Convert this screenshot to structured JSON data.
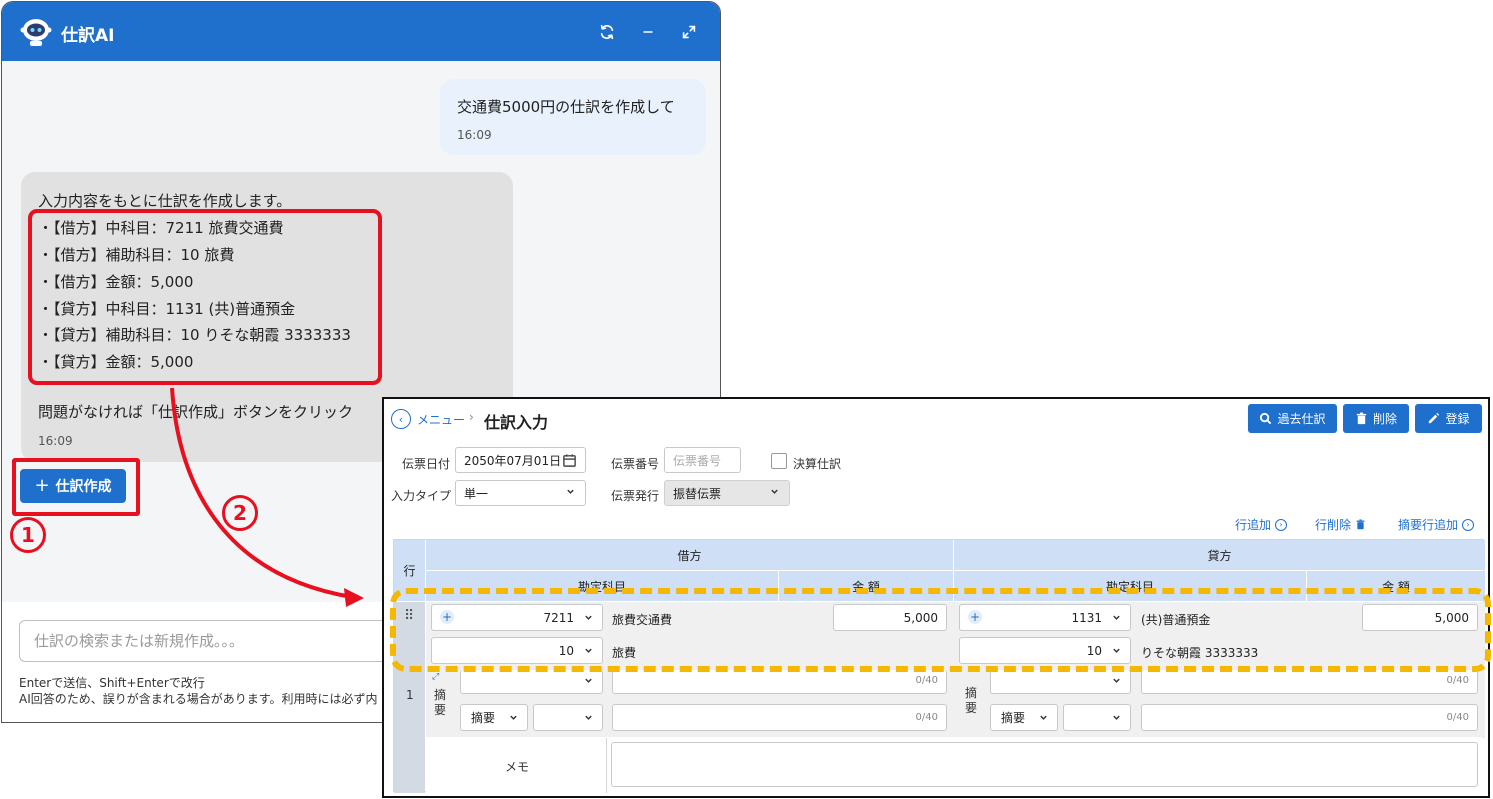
{
  "chat": {
    "title": "仕訳AI",
    "user_message": "交通費5000円の仕訳を作成して",
    "user_time": "16:09",
    "ai_intro": "入力内容をもとに仕訳を作成します。",
    "ai_lines": [
      "・【借方】中科目：7211 旅費交通費",
      "・【借方】補助科目：10 旅費",
      "・【借方】金額：5,000",
      "・【貸方】中科目：1131 (共)普通預金",
      "・【貸方】補助科目：10 りそな朝霞 3333333",
      "・【貸方】金額：5,000"
    ],
    "ai_note": "問題がなければ「仕訳作成」ボタンをクリック",
    "ai_time": "16:09",
    "create_button": "仕訳作成",
    "input_placeholder": "仕訳の検索または新規作成。。。",
    "footer_line1": "Enterで送信、Shift+Enterで改行",
    "footer_line2": "AI回答のため、誤りが含まれる場合があります。利用時には必ず内"
  },
  "steps": {
    "one": "1",
    "two": "2"
  },
  "journal": {
    "breadcrumb_menu": "メニュー",
    "breadcrumb_sep": "›",
    "title": "仕訳入力",
    "btn_history": "過去仕訳",
    "btn_delete": "削除",
    "btn_register": "登録",
    "label_date": "伝票日付",
    "date_value": "2050年07月01日",
    "label_number": "伝票番号",
    "number_placeholder": "伝票番号",
    "label_settlement": "決算仕訳",
    "label_input_type": "入力タイプ",
    "input_type_value": "単一",
    "label_issue": "伝票発行",
    "issue_value": "振替伝票",
    "action_add_row": "行追加",
    "action_delete_row": "行削除",
    "action_add_summary": "摘要行追加",
    "col_row": "行",
    "col_debit": "借方",
    "col_credit": "貸方",
    "col_account": "勘定科目",
    "col_amount": "金 額",
    "row_number": "1",
    "debit_account_code": "7211",
    "debit_account_name": "旅費交通費",
    "debit_amount": "5,000",
    "debit_sub_code": "10",
    "debit_sub_name": "旅費",
    "credit_account_code": "1131",
    "credit_account_name": "(共)普通預金",
    "credit_amount": "5,000",
    "credit_sub_code": "10",
    "credit_sub_name": "りそな朝霞 3333333",
    "summary_label": "摘\n要",
    "summary_select": "摘要",
    "counter": "0/40",
    "memo_label": "メモ"
  }
}
